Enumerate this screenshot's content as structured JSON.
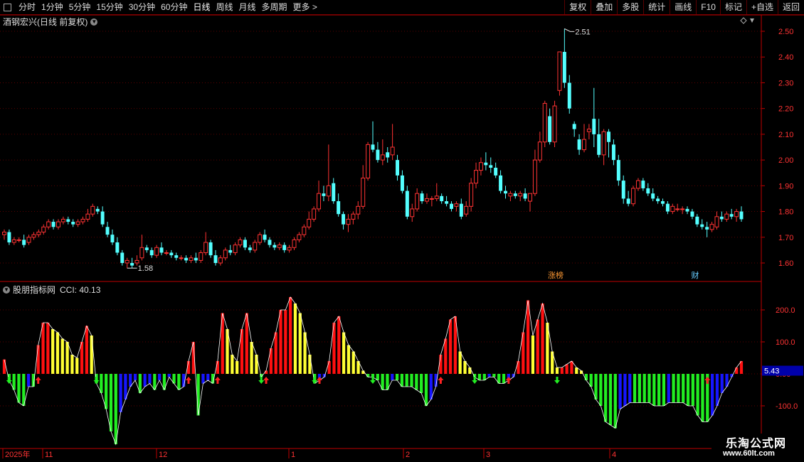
{
  "toolbar": {
    "left": [
      "分时",
      "1分钟",
      "5分钟",
      "15分钟",
      "30分钟",
      "60分钟",
      "日线",
      "周线",
      "月线",
      "多周期",
      "更多 >"
    ],
    "active": "日线",
    "right": [
      "复权",
      "叠加",
      "多股",
      "统计",
      "画线",
      "F10",
      "标记",
      "+自选",
      "返回"
    ]
  },
  "stock_title": "酒钢宏兴(日线 前复权)",
  "indicator_title": {
    "name": "股朋指标网",
    "cci_text": "CCI: 40.13"
  },
  "tags": [
    "涨榜",
    "财"
  ],
  "watermark": {
    "line1": "乐淘公式网",
    "line2": "www.60lt.com"
  },
  "colors": {
    "up": "#ff3333",
    "down": "#54ffff",
    "grid": "#5a0000",
    "axis": "#c00000",
    "cci_red": "#ff1010",
    "cci_yellow": "#ffff33",
    "cci_green": "#22ee22",
    "cci_blue": "#1616ff"
  },
  "chart_data": [
    {
      "type": "candlestick",
      "ylim": [
        1.55,
        2.55
      ],
      "yticks": [
        "1.60",
        "1.70",
        "1.80",
        "1.90",
        "2.00",
        "2.10",
        "2.20",
        "2.30",
        "2.40",
        "2.50"
      ],
      "annotations": [
        {
          "text": "2.51",
          "value": 2.51
        },
        {
          "text": "1.58",
          "value": 1.58
        }
      ],
      "ohlc": [
        [
          1.71,
          1.73,
          1.69,
          1.72
        ],
        [
          1.72,
          1.73,
          1.67,
          1.68
        ],
        [
          1.68,
          1.7,
          1.67,
          1.69
        ],
        [
          1.69,
          1.7,
          1.68,
          1.69
        ],
        [
          1.69,
          1.71,
          1.66,
          1.67
        ],
        [
          1.68,
          1.71,
          1.67,
          1.7
        ],
        [
          1.7,
          1.72,
          1.69,
          1.71
        ],
        [
          1.71,
          1.73,
          1.7,
          1.72
        ],
        [
          1.72,
          1.75,
          1.71,
          1.74
        ],
        [
          1.74,
          1.77,
          1.73,
          1.76
        ],
        [
          1.76,
          1.77,
          1.73,
          1.74
        ],
        [
          1.74,
          1.77,
          1.73,
          1.76
        ],
        [
          1.76,
          1.78,
          1.75,
          1.77
        ],
        [
          1.77,
          1.78,
          1.75,
          1.76
        ],
        [
          1.76,
          1.77,
          1.74,
          1.75
        ],
        [
          1.75,
          1.77,
          1.74,
          1.76
        ],
        [
          1.76,
          1.78,
          1.75,
          1.77
        ],
        [
          1.77,
          1.81,
          1.76,
          1.79
        ],
        [
          1.79,
          1.83,
          1.78,
          1.82
        ],
        [
          1.81,
          1.82,
          1.79,
          1.8
        ],
        [
          1.8,
          1.82,
          1.74,
          1.75
        ],
        [
          1.74,
          1.76,
          1.7,
          1.71
        ],
        [
          1.71,
          1.73,
          1.67,
          1.68
        ],
        [
          1.68,
          1.7,
          1.63,
          1.64
        ],
        [
          1.64,
          1.65,
          1.59,
          1.6
        ],
        [
          1.6,
          1.62,
          1.58,
          1.61
        ],
        [
          1.6,
          1.62,
          1.58,
          1.59
        ],
        [
          1.6,
          1.63,
          1.59,
          1.61
        ],
        [
          1.62,
          1.71,
          1.61,
          1.66
        ],
        [
          1.66,
          1.67,
          1.64,
          1.65
        ],
        [
          1.65,
          1.66,
          1.62,
          1.63
        ],
        [
          1.63,
          1.67,
          1.62,
          1.66
        ],
        [
          1.66,
          1.68,
          1.63,
          1.64
        ],
        [
          1.64,
          1.65,
          1.63,
          1.64
        ],
        [
          1.64,
          1.65,
          1.62,
          1.63
        ],
        [
          1.63,
          1.64,
          1.61,
          1.62
        ],
        [
          1.62,
          1.63,
          1.61,
          1.62
        ],
        [
          1.62,
          1.63,
          1.6,
          1.61
        ],
        [
          1.61,
          1.63,
          1.6,
          1.62
        ],
        [
          1.62,
          1.64,
          1.6,
          1.61
        ],
        [
          1.61,
          1.65,
          1.6,
          1.64
        ],
        [
          1.64,
          1.72,
          1.63,
          1.68
        ],
        [
          1.68,
          1.69,
          1.62,
          1.63
        ],
        [
          1.63,
          1.65,
          1.59,
          1.6
        ],
        [
          1.6,
          1.63,
          1.59,
          1.62
        ],
        [
          1.62,
          1.66,
          1.61,
          1.65
        ],
        [
          1.65,
          1.67,
          1.63,
          1.64
        ],
        [
          1.64,
          1.68,
          1.63,
          1.67
        ],
        [
          1.67,
          1.7,
          1.66,
          1.69
        ],
        [
          1.69,
          1.7,
          1.65,
          1.66
        ],
        [
          1.66,
          1.67,
          1.64,
          1.65
        ],
        [
          1.65,
          1.69,
          1.64,
          1.68
        ],
        [
          1.68,
          1.72,
          1.67,
          1.71
        ],
        [
          1.71,
          1.73,
          1.68,
          1.69
        ],
        [
          1.69,
          1.7,
          1.66,
          1.67
        ],
        [
          1.67,
          1.68,
          1.65,
          1.66
        ],
        [
          1.66,
          1.68,
          1.65,
          1.67
        ],
        [
          1.67,
          1.68,
          1.64,
          1.65
        ],
        [
          1.65,
          1.67,
          1.64,
          1.66
        ],
        [
          1.66,
          1.7,
          1.65,
          1.69
        ],
        [
          1.69,
          1.72,
          1.68,
          1.71
        ],
        [
          1.71,
          1.75,
          1.7,
          1.74
        ],
        [
          1.74,
          1.8,
          1.73,
          1.77
        ],
        [
          1.77,
          1.82,
          1.76,
          1.81
        ],
        [
          1.81,
          1.92,
          1.8,
          1.87
        ],
        [
          1.87,
          1.9,
          1.84,
          1.86
        ],
        [
          1.86,
          2.06,
          1.84,
          1.9
        ],
        [
          1.91,
          1.93,
          1.83,
          1.84
        ],
        [
          1.84,
          1.87,
          1.78,
          1.79
        ],
        [
          1.79,
          1.8,
          1.73,
          1.75
        ],
        [
          1.75,
          1.79,
          1.72,
          1.77
        ],
        [
          1.77,
          1.8,
          1.75,
          1.79
        ],
        [
          1.79,
          1.84,
          1.77,
          1.82
        ],
        [
          1.82,
          1.98,
          1.81,
          1.93
        ],
        [
          1.93,
          2.07,
          1.92,
          2.06
        ],
        [
          2.06,
          2.15,
          2.03,
          2.04
        ],
        [
          2.04,
          2.07,
          1.99,
          2.0
        ],
        [
          2.0,
          2.08,
          1.98,
          2.02
        ],
        [
          2.03,
          2.05,
          1.99,
          2.01
        ],
        [
          2.02,
          2.14,
          2.0,
          2.05
        ],
        [
          2.0,
          2.02,
          1.92,
          1.94
        ],
        [
          1.94,
          1.96,
          1.87,
          1.88
        ],
        [
          1.88,
          1.9,
          1.77,
          1.78
        ],
        [
          1.78,
          1.83,
          1.76,
          1.81
        ],
        [
          1.81,
          1.89,
          1.8,
          1.87
        ],
        [
          1.87,
          1.88,
          1.83,
          1.84
        ],
        [
          1.84,
          1.87,
          1.83,
          1.85
        ],
        [
          1.85,
          1.86,
          1.82,
          1.85
        ],
        [
          1.85,
          1.91,
          1.84,
          1.86
        ],
        [
          1.86,
          1.87,
          1.83,
          1.84
        ],
        [
          1.84,
          1.86,
          1.82,
          1.83
        ],
        [
          1.83,
          1.84,
          1.8,
          1.81
        ],
        [
          1.82,
          1.84,
          1.8,
          1.83
        ],
        [
          1.83,
          1.85,
          1.77,
          1.78
        ],
        [
          1.79,
          1.84,
          1.78,
          1.82
        ],
        [
          1.82,
          1.93,
          1.8,
          1.91
        ],
        [
          1.91,
          1.99,
          1.89,
          1.96
        ],
        [
          1.96,
          2.01,
          1.94,
          1.99
        ],
        [
          1.99,
          2.03,
          1.96,
          1.98
        ],
        [
          1.98,
          2.01,
          1.95,
          1.97
        ],
        [
          1.97,
          1.99,
          1.93,
          1.94
        ],
        [
          1.94,
          1.96,
          1.87,
          1.88
        ],
        [
          1.88,
          1.9,
          1.85,
          1.87
        ],
        [
          1.86,
          1.88,
          1.84,
          1.87
        ],
        [
          1.87,
          1.88,
          1.85,
          1.86
        ],
        [
          1.86,
          1.88,
          1.84,
          1.87
        ],
        [
          1.87,
          1.89,
          1.84,
          1.85
        ],
        [
          1.84,
          1.87,
          1.8,
          1.87
        ],
        [
          1.87,
          2.04,
          1.86,
          2.0
        ],
        [
          2.0,
          2.11,
          1.99,
          2.07
        ],
        [
          2.07,
          2.23,
          2.05,
          2.22
        ],
        [
          2.17,
          2.2,
          2.06,
          2.07
        ],
        [
          2.07,
          2.23,
          2.05,
          2.21
        ],
        [
          2.27,
          2.38,
          2.25,
          2.42
        ],
        [
          2.42,
          2.51,
          2.28,
          2.3
        ],
        [
          2.3,
          2.33,
          2.18,
          2.2
        ],
        [
          2.14,
          2.15,
          2.09,
          2.12
        ],
        [
          2.08,
          2.1,
          2.02,
          2.04
        ],
        [
          2.04,
          2.14,
          2.03,
          2.08
        ],
        [
          2.11,
          2.14,
          2.08,
          2.12
        ],
        [
          2.16,
          2.28,
          2.05,
          2.1
        ],
        [
          2.1,
          2.16,
          2.01,
          2.02
        ],
        [
          2.02,
          2.12,
          1.98,
          2.11
        ],
        [
          2.11,
          2.12,
          2.01,
          2.07
        ],
        [
          2.06,
          2.08,
          1.98,
          2.0
        ],
        [
          2.0,
          2.02,
          1.9,
          1.92
        ],
        [
          1.92,
          1.94,
          1.83,
          1.85
        ],
        [
          1.85,
          1.88,
          1.82,
          1.83
        ],
        [
          1.83,
          1.9,
          1.82,
          1.89
        ],
        [
          1.89,
          1.93,
          1.88,
          1.92
        ],
        [
          1.92,
          1.93,
          1.88,
          1.89
        ],
        [
          1.89,
          1.91,
          1.86,
          1.87
        ],
        [
          1.87,
          1.89,
          1.84,
          1.85
        ],
        [
          1.85,
          1.86,
          1.83,
          1.84
        ],
        [
          1.84,
          1.85,
          1.82,
          1.83
        ],
        [
          1.83,
          1.84,
          1.79,
          1.8
        ],
        [
          1.8,
          1.83,
          1.79,
          1.82
        ],
        [
          1.81,
          1.83,
          1.8,
          1.81
        ],
        [
          1.81,
          1.82,
          1.79,
          1.81
        ],
        [
          1.81,
          1.82,
          1.79,
          1.8
        ],
        [
          1.8,
          1.81,
          1.77,
          1.78
        ],
        [
          1.78,
          1.79,
          1.74,
          1.75
        ],
        [
          1.75,
          1.77,
          1.73,
          1.74
        ],
        [
          1.74,
          1.76,
          1.7,
          1.73
        ],
        [
          1.73,
          1.76,
          1.72,
          1.75
        ],
        [
          1.74,
          1.8,
          1.73,
          1.78
        ],
        [
          1.78,
          1.8,
          1.76,
          1.77
        ],
        [
          1.77,
          1.8,
          1.76,
          1.79
        ],
        [
          1.79,
          1.81,
          1.77,
          1.78
        ],
        [
          1.78,
          1.81,
          1.76,
          1.8
        ],
        [
          1.8,
          1.82,
          1.76,
          1.77
        ]
      ]
    },
    {
      "type": "bar",
      "title": "股朋指标网",
      "label": "CCI: 40.13",
      "current_value_label": "5.43",
      "ylim": [
        -230,
        250
      ],
      "yticks": [
        "200.0",
        "100.0",
        "0.00",
        "-100.0"
      ],
      "values": [
        45,
        -20,
        -50,
        -90,
        -100,
        -40,
        -40,
        90,
        160,
        160,
        140,
        130,
        110,
        100,
        60,
        50,
        100,
        150,
        120,
        -30,
        -60,
        -110,
        -180,
        -220,
        -120,
        -80,
        -40,
        -20,
        -60,
        -40,
        -30,
        -50,
        -20,
        -50,
        -10,
        -30,
        -50,
        -40,
        40,
        100,
        -130,
        -30,
        -20,
        -30,
        40,
        190,
        140,
        60,
        40,
        140,
        190,
        100,
        60,
        -10,
        10,
        80,
        130,
        200,
        200,
        240,
        220,
        190,
        130,
        60,
        -30,
        -20,
        -10,
        40,
        160,
        180,
        130,
        90,
        70,
        40,
        10,
        -10,
        -10,
        -20,
        -50,
        -50,
        -20,
        -20,
        -40,
        -40,
        -40,
        -50,
        -60,
        -100,
        -80,
        -40,
        60,
        110,
        170,
        180,
        70,
        40,
        20,
        -10,
        -20,
        -20,
        -10,
        -10,
        -30,
        -30,
        -20,
        -10,
        40,
        130,
        230,
        120,
        170,
        220,
        160,
        70,
        20,
        20,
        30,
        40,
        20,
        10,
        -20,
        -40,
        -80,
        -100,
        -150,
        -160,
        -170,
        -110,
        -100,
        -90,
        -90,
        -90,
        -90,
        -90,
        -100,
        -100,
        -100,
        -90,
        -90,
        -90,
        -90,
        -100,
        -100,
        -130,
        -150,
        -150,
        -130,
        -100,
        -60,
        -40,
        -10,
        20,
        40
      ],
      "signals": [
        {
          "type": "down",
          "index": 1
        },
        {
          "type": "up",
          "index": 7
        },
        {
          "type": "down",
          "index": 19
        },
        {
          "type": "up",
          "index": 38
        },
        {
          "type": "up",
          "index": 44
        },
        {
          "type": "down",
          "index": 53
        },
        {
          "type": "up",
          "index": 54
        },
        {
          "type": "down",
          "index": 64
        },
        {
          "type": "up",
          "index": 65
        },
        {
          "type": "down",
          "index": 76
        },
        {
          "type": "up",
          "index": 90
        },
        {
          "type": "down",
          "index": 97
        },
        {
          "type": "up",
          "index": 104
        },
        {
          "type": "down",
          "index": 114
        },
        {
          "type": "up",
          "index": 145
        }
      ]
    }
  ],
  "x_axis": {
    "labels": [
      "2025年",
      "11",
      "12",
      "1",
      "2",
      "3",
      "4"
    ]
  }
}
